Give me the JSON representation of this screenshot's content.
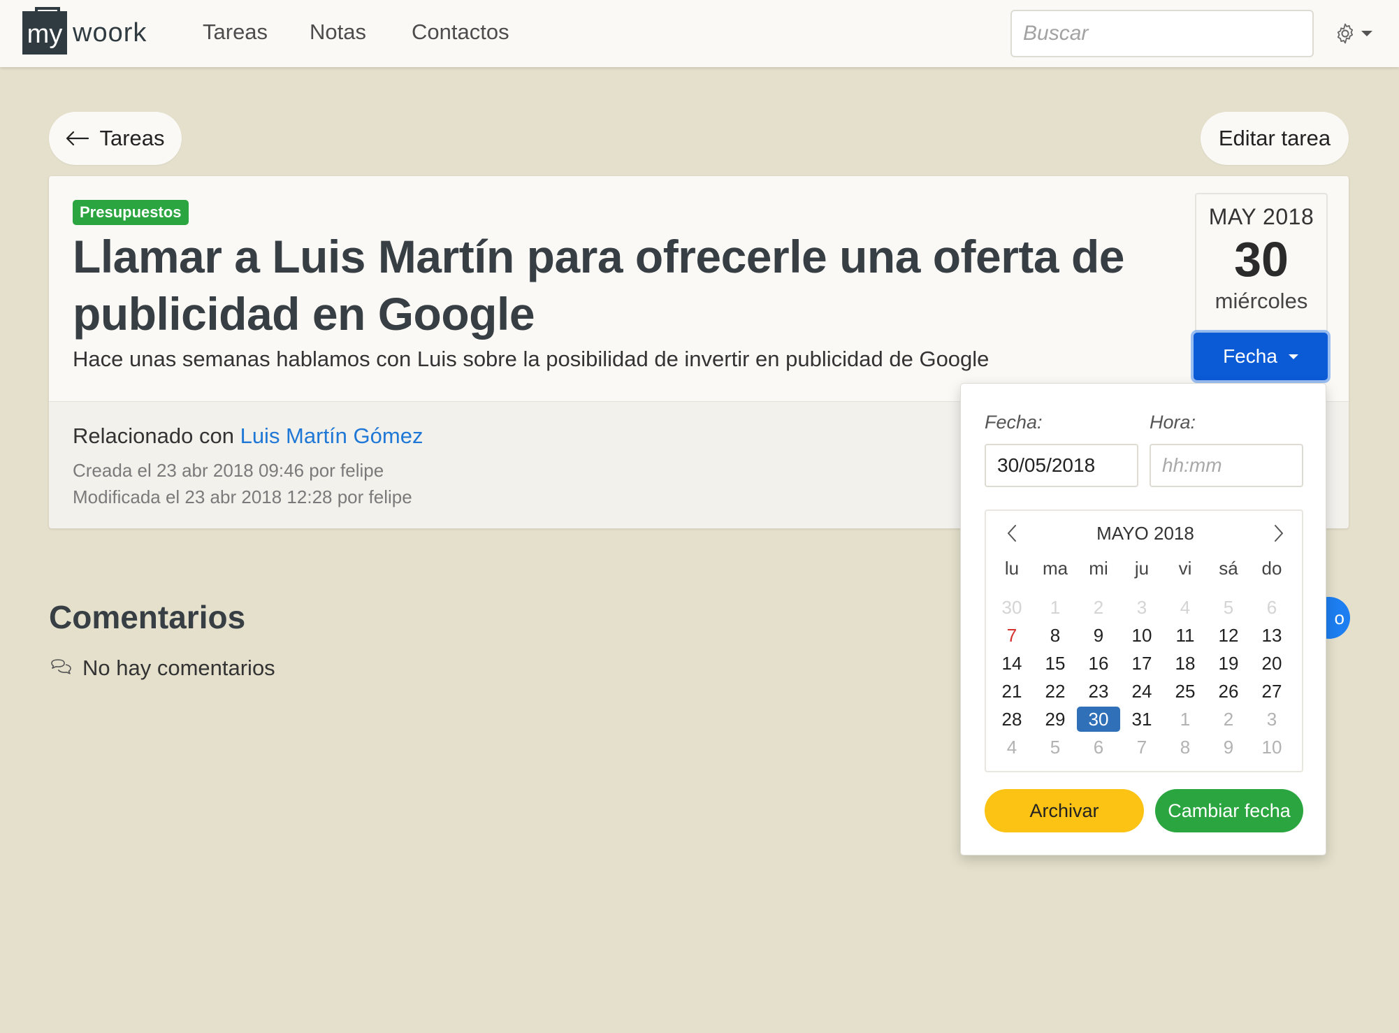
{
  "navbar": {
    "logo_box": "my",
    "logo_word": "woork",
    "links": [
      "Tareas",
      "Notas",
      "Contactos"
    ],
    "search_placeholder": "Buscar",
    "settings_icon": "gear-icon"
  },
  "toolbar": {
    "back_label": "Tareas",
    "edit_label": "Editar tarea"
  },
  "task": {
    "tag": "Presupuestos",
    "tag_color": "#2aa53f",
    "title": "Llamar a Luis Martín para ofrecerle una oferta de publicidad en Google",
    "description": "Hace unas semanas hablamos con Luis sobre la posibilidad de invertir en publicidad de Google",
    "related_prefix": "Relacionado con",
    "related_contact": "Luis Martín Gómez",
    "created": "Creada el 23 abr 2018 09:46 por felipe",
    "modified": "Modificada el 23 abr 2018 12:28 por felipe"
  },
  "due_date": {
    "month_year": "MAY 2018",
    "day": "30",
    "weekday": "miércoles",
    "button_label": "Fecha"
  },
  "comments": {
    "title": "Comentarios",
    "empty_text": "No hay comentarios"
  },
  "hidden_button_text": "o",
  "popover": {
    "date_label": "Fecha:",
    "time_label": "Hora:",
    "date_value": "30/05/2018",
    "time_placeholder": "hh:mm",
    "calendar": {
      "month_label": "MAYO 2018",
      "weekdays": [
        "lu",
        "ma",
        "mi",
        "ju",
        "vi",
        "sá",
        "do"
      ],
      "weeks": [
        [
          {
            "d": "30",
            "s": "faint"
          },
          {
            "d": "1",
            "s": "faint"
          },
          {
            "d": "2",
            "s": "faint"
          },
          {
            "d": "3",
            "s": "faint"
          },
          {
            "d": "4",
            "s": "faint"
          },
          {
            "d": "5",
            "s": "faint"
          },
          {
            "d": "6",
            "s": "faint"
          }
        ],
        [
          {
            "d": "7",
            "s": "today"
          },
          {
            "d": "8",
            "s": ""
          },
          {
            "d": "9",
            "s": ""
          },
          {
            "d": "10",
            "s": ""
          },
          {
            "d": "11",
            "s": ""
          },
          {
            "d": "12",
            "s": ""
          },
          {
            "d": "13",
            "s": ""
          }
        ],
        [
          {
            "d": "14",
            "s": ""
          },
          {
            "d": "15",
            "s": ""
          },
          {
            "d": "16",
            "s": ""
          },
          {
            "d": "17",
            "s": ""
          },
          {
            "d": "18",
            "s": ""
          },
          {
            "d": "19",
            "s": ""
          },
          {
            "d": "20",
            "s": ""
          }
        ],
        [
          {
            "d": "21",
            "s": ""
          },
          {
            "d": "22",
            "s": ""
          },
          {
            "d": "23",
            "s": ""
          },
          {
            "d": "24",
            "s": ""
          },
          {
            "d": "25",
            "s": ""
          },
          {
            "d": "26",
            "s": ""
          },
          {
            "d": "27",
            "s": ""
          }
        ],
        [
          {
            "d": "28",
            "s": ""
          },
          {
            "d": "29",
            "s": ""
          },
          {
            "d": "30",
            "s": "sel"
          },
          {
            "d": "31",
            "s": ""
          },
          {
            "d": "1",
            "s": "muted"
          },
          {
            "d": "2",
            "s": "muted"
          },
          {
            "d": "3",
            "s": "muted"
          }
        ],
        [
          {
            "d": "4",
            "s": "muted"
          },
          {
            "d": "5",
            "s": "muted"
          },
          {
            "d": "6",
            "s": "muted"
          },
          {
            "d": "7",
            "s": "muted"
          },
          {
            "d": "8",
            "s": "muted"
          },
          {
            "d": "9",
            "s": "muted"
          },
          {
            "d": "10",
            "s": "muted"
          }
        ]
      ]
    },
    "archive_label": "Archivar",
    "change_label": "Cambiar fecha"
  }
}
